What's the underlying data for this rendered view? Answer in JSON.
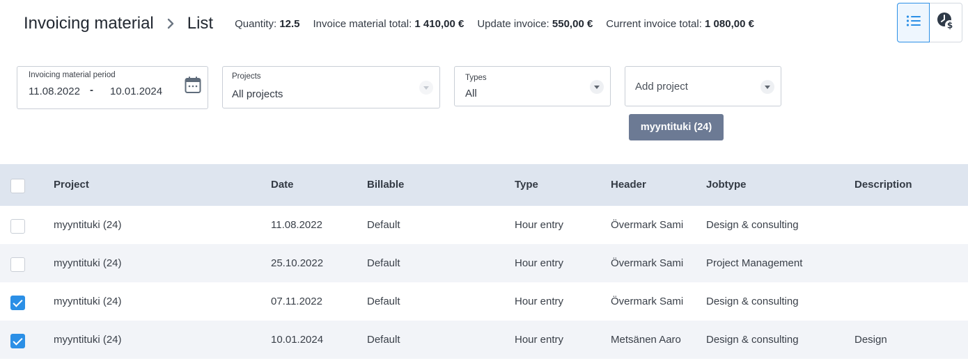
{
  "breadcrumb": {
    "root": "Invoicing material",
    "current": "List"
  },
  "stats": [
    {
      "label": "Quantity:",
      "value": "12.5"
    },
    {
      "label": "Invoice material total:",
      "value": "1 410,00 €"
    },
    {
      "label": "Update invoice:",
      "value": "550,00 €"
    },
    {
      "label": "Current invoice total:",
      "value": "1 080,00 €"
    }
  ],
  "view_toggle": {
    "active": "list-view",
    "icons": [
      "list-icon",
      "time-money-icon"
    ]
  },
  "filters": {
    "period": {
      "label": "Invoicing material period",
      "start": "11.08.2022",
      "separator": "-",
      "end": "10.01.2024"
    },
    "projects": {
      "label": "Projects",
      "value": "All projects"
    },
    "types": {
      "label": "Types",
      "value": "All"
    },
    "add_project": {
      "placeholder": "Add project"
    }
  },
  "selected_chip": "myyntituki (24)",
  "table": {
    "columns": [
      "Project",
      "Date",
      "Billable",
      "Type",
      "Header",
      "Jobtype",
      "Description"
    ],
    "rows": [
      {
        "checked": false,
        "project": "myyntituki (24)",
        "date": "11.08.2022",
        "billable": "Default",
        "type": "Hour entry",
        "header": "Övermark Sami",
        "jobtype": "Design & consulting",
        "description": ""
      },
      {
        "checked": false,
        "project": "myyntituki (24)",
        "date": "25.10.2022",
        "billable": "Default",
        "type": "Hour entry",
        "header": "Övermark Sami",
        "jobtype": "Project Management",
        "description": ""
      },
      {
        "checked": true,
        "project": "myyntituki (24)",
        "date": "07.11.2022",
        "billable": "Default",
        "type": "Hour entry",
        "header": "Övermark Sami",
        "jobtype": "Design & consulting",
        "description": ""
      },
      {
        "checked": true,
        "project": "myyntituki (24)",
        "date": "10.01.2024",
        "billable": "Default",
        "type": "Hour entry",
        "header": "Metsänen Aaro",
        "jobtype": "Design & consulting",
        "description": "Design"
      }
    ]
  },
  "colors": {
    "accent": "#2b8fe6",
    "header_bg": "#dee5ef",
    "chip_bg": "#6c7a94",
    "alt_row": "#f2f4f8"
  }
}
